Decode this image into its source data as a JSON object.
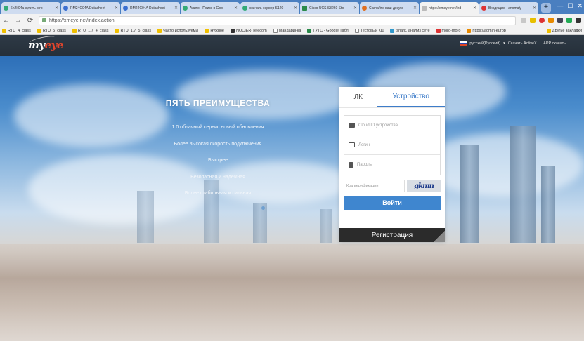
{
  "browser": {
    "tabs": [
      {
        "title": "6n2k04a купить в го"
      },
      {
        "title": "RM24C04A Datasheet"
      },
      {
        "title": "RM24C04A Datasheet"
      },
      {
        "title": "Авито - Поиск в Goo"
      },
      {
        "title": "скачать сервер S120"
      },
      {
        "title": "Cisco UCS S3260 Sto"
      },
      {
        "title": "Скачайте ваш докум"
      },
      {
        "title": "https://xmeye.net/ind",
        "active": true
      },
      {
        "title": "Входящие - anomaly"
      }
    ],
    "url": "https://xmeye.net/index.action",
    "bookmarks": [
      "RTU_4_class",
      "RTU_5_class",
      "RTU_1.7_4_class",
      "RTU_1.7_5_class",
      "Часто используемы",
      "Нужное",
      "NOCIER-Telecom",
      "Мандаринка",
      "ГУТС - Google Табл",
      "Тестовый КЦ",
      "tshark, анализ сете",
      "moro-moro",
      "https://admin-europ",
      "Другие закладки"
    ]
  },
  "site": {
    "logo_main": "my",
    "logo_accent": "eye",
    "language": "русский(Русский)",
    "download_activex": "Скачать ActiveX",
    "separator": "|",
    "download_app": "APP скачать"
  },
  "advantages": {
    "title": "ПЯТЬ ПРЕИМУЩЕСТВА",
    "items": [
      "1.0 облачный сервис новый обновления",
      "Более высокая скорость подключения",
      "Быстрее",
      "Безопасная и надежная",
      "Более стабильная и сильная"
    ]
  },
  "login": {
    "tab_lk": "ЛК",
    "tab_device": "Устройство",
    "cloud_id_placeholder": "Cloud ID устройства",
    "login_placeholder": "Логин",
    "password_placeholder": "Пароль",
    "captcha_placeholder": "Код верификации",
    "captcha_text": "gkmn",
    "submit": "Войти",
    "register": "Регистрация"
  }
}
